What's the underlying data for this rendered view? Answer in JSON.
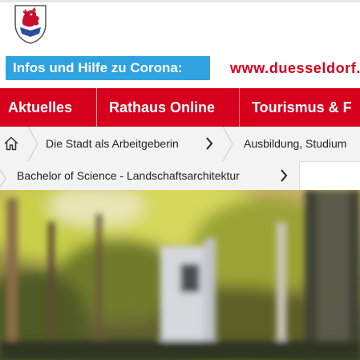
{
  "header": {
    "logo": "duesseldorf-coat-of-arms"
  },
  "corona": {
    "badge_label": "Infos und Hilfe zu Corona:",
    "site_url": "www.duesseldorf."
  },
  "main_nav": {
    "items": [
      {
        "label": "Aktuelles"
      },
      {
        "label": "Rathaus Online"
      },
      {
        "label": "Tourismus & F"
      }
    ]
  },
  "breadcrumb": {
    "home_icon": "home-icon",
    "items": [
      {
        "label": "Die Stadt als Arbeitgeberin"
      },
      {
        "label": "Ausbildung, Studium"
      },
      {
        "label": "Bachelor of Science - Landschaftsarchitektur"
      }
    ]
  },
  "colors": {
    "brand_red": "#d6001c",
    "corona_blue": "#2ea3e0",
    "breadcrumb_bg": "#f3f3f3"
  },
  "hero": {
    "image": "blurred-park-scene"
  }
}
